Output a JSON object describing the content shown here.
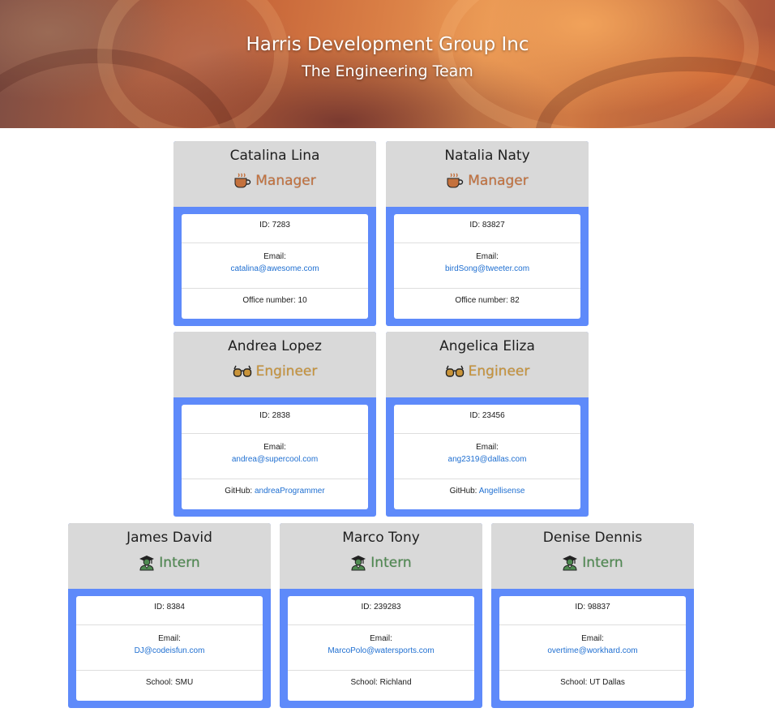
{
  "header": {
    "company": "Harris Development Group Inc",
    "team": "The Engineering Team"
  },
  "colors": {
    "manager_role": "#c4713d",
    "engineer_role": "#c9943a",
    "intern_role": "#4f8a51",
    "card_border": "#5e8afa",
    "card_header": "#d9d9d9",
    "link": "#1f6fd1"
  },
  "employees": [
    {
      "name": "Catalina Lina",
      "role": "Manager",
      "icon": "coffee-icon",
      "id_text": "ID: 7283",
      "email_label": "Email:",
      "email": "catalina@awesome.com",
      "extra_label": "Office number: 10",
      "extra_value": ""
    },
    {
      "name": "Natalia Naty",
      "role": "Manager",
      "icon": "coffee-icon",
      "id_text": "ID: 83827",
      "email_label": "Email:",
      "email": "birdSong@tweeter.com",
      "extra_label": "Office number: 82",
      "extra_value": ""
    },
    {
      "name": "Andrea Lopez",
      "role": "Engineer",
      "icon": "glasses-icon",
      "id_text": "ID: 2838",
      "email_label": "Email:",
      "email": "andrea@supercool.com",
      "extra_label": "GitHub: ",
      "extra_value": "andreaProgrammer"
    },
    {
      "name": "Angelica Eliza",
      "role": "Engineer",
      "icon": "glasses-icon",
      "id_text": "ID: 23456",
      "email_label": "Email:",
      "email": "ang2319@dallas.com",
      "extra_label": "GitHub: ",
      "extra_value": "Angellisense"
    },
    {
      "name": "James David",
      "role": "Intern",
      "icon": "graduate-icon",
      "id_text": "ID: 8384",
      "email_label": "Email:",
      "email": "DJ@codeisfun.com",
      "extra_label": "School: SMU",
      "extra_value": ""
    },
    {
      "name": "Marco Tony",
      "role": "Intern",
      "icon": "graduate-icon",
      "id_text": "ID: 239283",
      "email_label": "Email:",
      "email": "MarcoPolo@watersports.com",
      "extra_label": "School: Richland",
      "extra_value": ""
    },
    {
      "name": "Denise Dennis",
      "role": "Intern",
      "icon": "graduate-icon",
      "id_text": "ID: 98837",
      "email_label": "Email:",
      "email": "overtime@workhard.com",
      "extra_label": "School: UT Dallas",
      "extra_value": ""
    }
  ]
}
